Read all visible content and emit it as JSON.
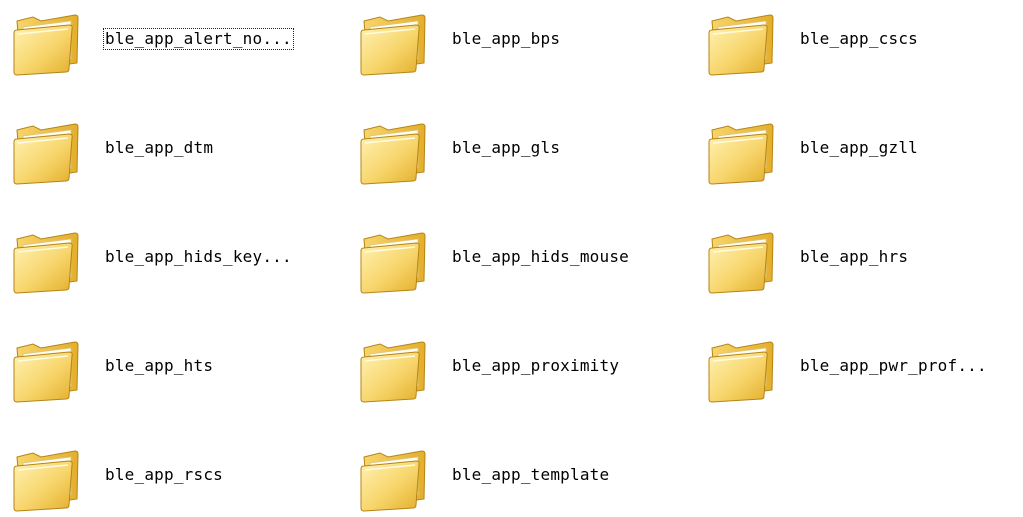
{
  "folders": [
    {
      "name": "ble_app_alert_no...",
      "focused": true
    },
    {
      "name": "ble_app_bps"
    },
    {
      "name": "ble_app_cscs"
    },
    {
      "name": "ble_app_dtm"
    },
    {
      "name": "ble_app_gls"
    },
    {
      "name": "ble_app_gzll"
    },
    {
      "name": "ble_app_hids_key..."
    },
    {
      "name": "ble_app_hids_mouse"
    },
    {
      "name": "ble_app_hrs"
    },
    {
      "name": "ble_app_hts"
    },
    {
      "name": "ble_app_proximity"
    },
    {
      "name": "ble_app_pwr_prof..."
    },
    {
      "name": "ble_app_rscs"
    },
    {
      "name": "ble_app_template"
    }
  ],
  "icon": "folder-icon",
  "colors": {
    "folder_light": "#FFF2B3",
    "folder_mid": "#F7D56B",
    "folder_dark": "#E3AE2B",
    "folder_edge": "#B58416"
  }
}
